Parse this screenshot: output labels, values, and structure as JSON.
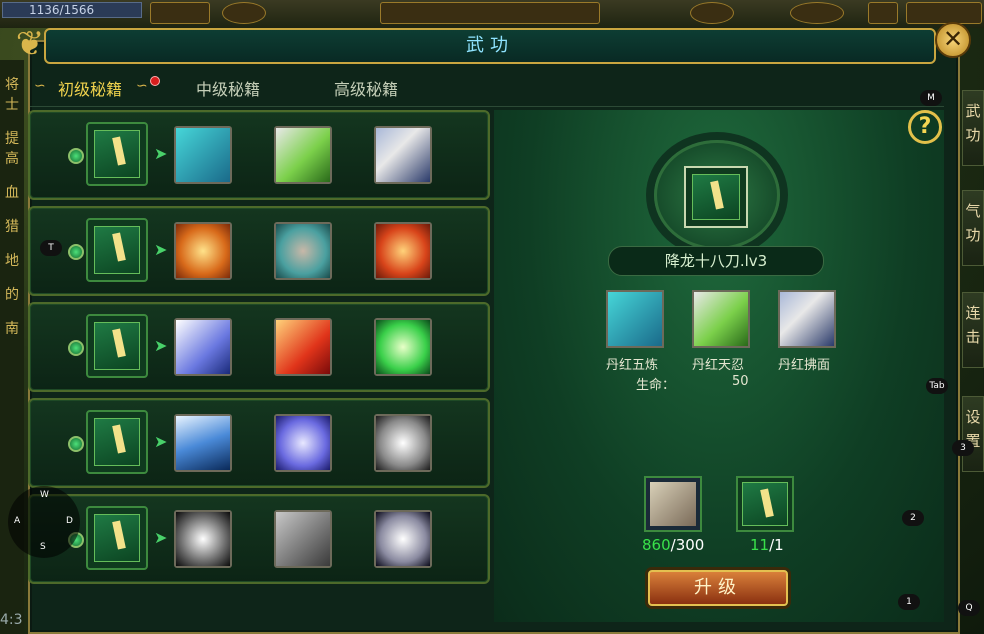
{
  "hud": {
    "hp_text": "1136/1566"
  },
  "window": {
    "title": "武功",
    "close_icon": "close-icon"
  },
  "tabs": [
    {
      "label": "初级秘籍",
      "active": true,
      "has_badge": true
    },
    {
      "label": "中级秘籍",
      "active": false
    },
    {
      "label": "高级秘籍",
      "active": false
    }
  ],
  "rows": [
    {
      "skills": [
        "stone-golem-icon",
        "green-slash-icon",
        "wind-blade-icon"
      ]
    },
    {
      "skills": [
        "golden-helm-icon",
        "claw-hand-icon",
        "fire-vortex-icon"
      ]
    },
    {
      "skills": [
        "spirit-burst-icon",
        "flame-strike-icon",
        "green-swirl-icon"
      ]
    },
    {
      "skills": [
        "blue-crescent-icon",
        "cross-slash-icon",
        "white-rune-icon"
      ]
    },
    {
      "skills": [
        "chain-ring-icon",
        "dark-strike-icon",
        "star-shatter-icon"
      ]
    }
  ],
  "detail": {
    "name": "降龙十八刀.lv3",
    "skills": [
      {
        "label": "丹红五炼",
        "icon": "stone-golem-icon"
      },
      {
        "label": "丹红天忍",
        "icon": "green-slash-icon"
      },
      {
        "label": "丹红拂面",
        "icon": "wind-blade-icon"
      }
    ],
    "stat": {
      "label": "生命：",
      "value": "50"
    },
    "materials": [
      {
        "have": "860",
        "need": "/300",
        "icon": "stone-fragment-icon"
      },
      {
        "have": "11",
        "need": "/1",
        "icon": "skill-book-icon"
      }
    ],
    "upgrade_label": "升级"
  },
  "hotkeys": {
    "m": "M",
    "t": "T",
    "tab": "Tab",
    "k2": "2",
    "k1": "1",
    "k3": "3",
    "q": "Q"
  },
  "dpad": {
    "w": "W",
    "a": "A",
    "s": "S",
    "d": "D"
  },
  "side_right": [
    "武功",
    "气功",
    "连击",
    "设置"
  ],
  "side_left": [
    "将士",
    "提高",
    "血",
    "猎",
    "地",
    "的",
    "南"
  ],
  "clock": "4:3",
  "help_label": "?"
}
